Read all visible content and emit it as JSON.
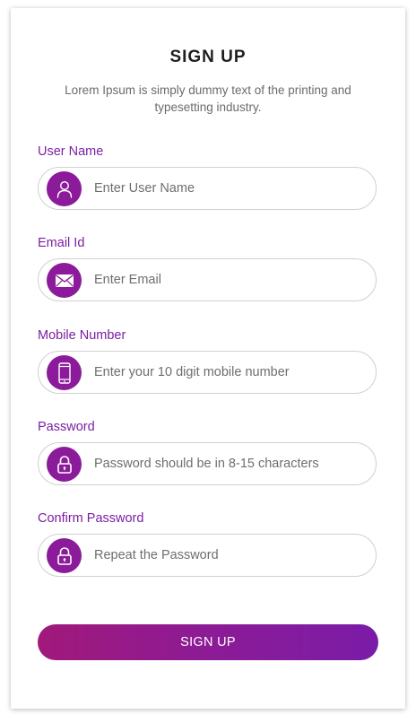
{
  "header": {
    "title": "SIGN UP",
    "subtitle": "Lorem Ipsum is simply dummy text of the printing and typesetting industry."
  },
  "fields": {
    "username": {
      "label": "User Name",
      "placeholder": "Enter User Name",
      "icon": "user-icon"
    },
    "email": {
      "label": "Email Id",
      "placeholder": "Enter Email",
      "icon": "envelope-icon"
    },
    "mobile": {
      "label": "Mobile Number",
      "placeholder": "Enter your 10 digit mobile number",
      "icon": "phone-icon"
    },
    "password": {
      "label": "Password",
      "placeholder": "Password should be in 8-15 characters",
      "icon": "lock-icon"
    },
    "confirm_password": {
      "label": "Confirm Password",
      "placeholder": "Repeat the Password",
      "icon": "lock-icon"
    }
  },
  "submit": {
    "label": "SIGN UP"
  },
  "colors": {
    "accent": "#7b1fa2",
    "icon_bg": "#8b1b9b",
    "button_gradient_start": "#a1197a",
    "button_gradient_end": "#7a1ca8"
  }
}
